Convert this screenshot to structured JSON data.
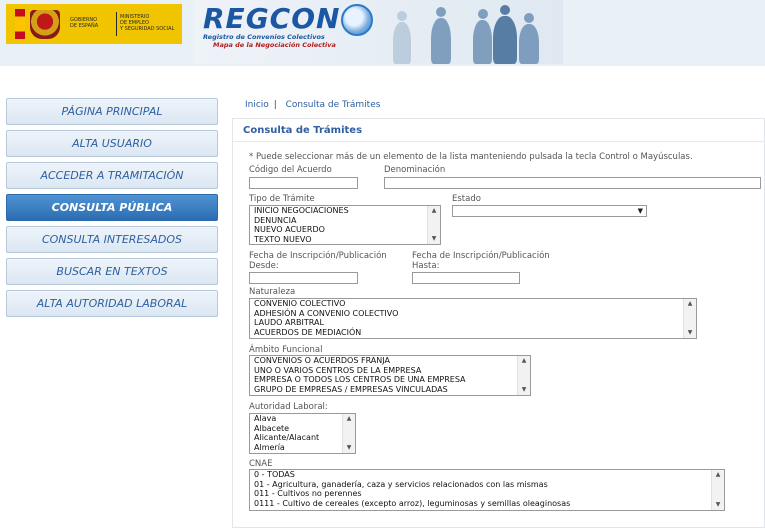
{
  "header": {
    "gov_left_lines": [
      "GOBIERNO",
      "DE ESPAÑA"
    ],
    "gov_right_lines": [
      "MINISTERIO",
      "DE EMPLEO",
      "Y SEGURIDAD SOCIAL"
    ],
    "app_title": "REGCON",
    "app_subtitle": "Registro de Convenios Colectivos",
    "app_subtitle2": "Mapa de la Negociación Colectiva"
  },
  "nav": {
    "items": [
      {
        "label": "PÁGINA PRINCIPAL"
      },
      {
        "label": "ALTA USUARIO"
      },
      {
        "label": "ACCEDER A TRAMITACIÓN"
      },
      {
        "label": "CONSULTA PÚBLICA"
      },
      {
        "label": "CONSULTA INTERESADOS"
      },
      {
        "label": "BUSCAR EN TEXTOS"
      },
      {
        "label": "ALTA AUTORIDAD LABORAL"
      }
    ],
    "active": "CONSULTA PÚBLICA"
  },
  "breadcrumb": {
    "home": "Inicio",
    "separator": "|",
    "current": "Consulta de Trámites"
  },
  "form": {
    "title": "Consulta de Trámites",
    "note": "* Puede seleccionar más de un elemento de la lista manteniendo pulsada la tecla Control o Mayúsculas.",
    "codigo_label": "Código del Acuerdo",
    "codigo_value": "",
    "denominacion_label": "Denominación",
    "denominacion_value": "",
    "tipo_label": "Tipo de Trámite",
    "tipo_options": [
      "INICIO NEGOCIACIONES",
      "DENUNCIA",
      "NUEVO ACUERDO",
      "TEXTO NUEVO"
    ],
    "estado_label": "Estado",
    "estado_value": "",
    "fecha_desde_label": "Fecha de Inscripción/Publicación",
    "fecha_desde_sub": "Desde:",
    "fecha_desde_value": "",
    "fecha_hasta_label": "Fecha de Inscripción/Publicación",
    "fecha_hasta_sub": "Hasta:",
    "fecha_hasta_value": "",
    "naturaleza_label": "Naturaleza",
    "naturaleza_options": [
      "CONVENIO COLECTIVO",
      "ADHESIÓN A CONVENIO COLECTIVO",
      "LAUDO ARBITRAL",
      "ACUERDOS DE MEDIACIÓN"
    ],
    "ambito_label": "Ámbito Funcional",
    "ambito_options": [
      "CONVENIOS O ACUERDOS FRANJA",
      "UNO O VARIOS CENTROS DE LA EMPRESA",
      "EMPRESA O TODOS LOS CENTROS DE UNA EMPRESA",
      "GRUPO DE EMPRESAS / EMPRESAS VINCULADAS"
    ],
    "autoridad_label": "Autoridad Laboral:",
    "autoridad_options": [
      "Alava",
      "Albacete",
      "Alicante/Alacant",
      "Almería"
    ],
    "cnae_label": "CNAE",
    "cnae_options": [
      "0 - TODAS",
      "01 - Agricultura, ganadería, caza y servicios relacionados con las mismas",
      "011 - Cultivos no perennes",
      "0111 - Cultivo de cereales (excepto arroz), leguminosas y semillas oleaginosas"
    ]
  },
  "icons": {
    "scroll_up": "▲",
    "scroll_down": "▼",
    "dropdown": "▼"
  }
}
